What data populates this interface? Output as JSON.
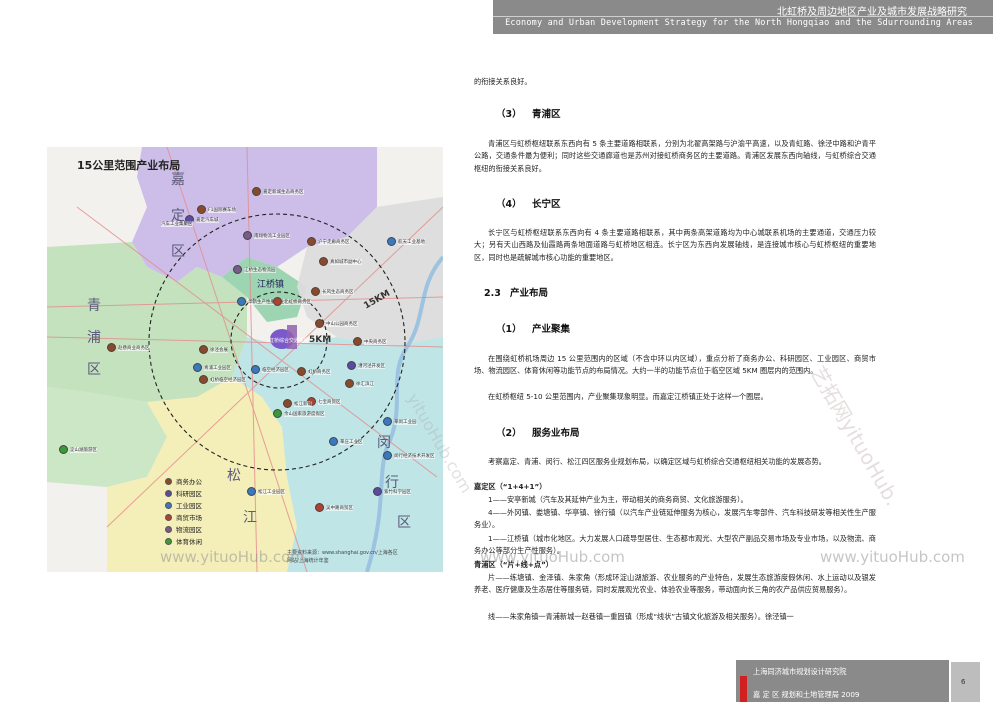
{
  "header": {
    "title_cn": "北虹桥及周边地区产业及城市发展战略研究",
    "title_en": "Economy and Urban Development Strategy for the North Hongqiao and the Sdurrounding Areas"
  },
  "map": {
    "title": "15公里范围产业布局",
    "regions": [
      "嘉",
      "定",
      "区",
      "青",
      "浦",
      "区",
      "松",
      "江",
      "闵",
      "行",
      "区",
      "江桥镇"
    ],
    "km15": "15KM",
    "km5": "5KM",
    "center_label": "虹桥综合交通枢纽",
    "nodes": [
      "嘉定汽车城",
      "汽车工业集聚区",
      "F1国际赛车场",
      "嘉定新城生态商务区",
      "南翔物流工业园区",
      "江桥生态物流园",
      "华新生产性服务业区",
      "沪宁走廊商务区",
      "真如城市副中心",
      "长风生态商务区",
      "中山公园商务区",
      "北虹桥商务区",
      "临空经济园区",
      "虹桥商务区",
      "中央商务区",
      "莘庄工业区",
      "漕河泾开发区",
      "徐汇滨江",
      "七宝商贸区",
      "闵行经济技术开发区",
      "松江工业园区",
      "松江新城",
      "佘山国家旅游度假区",
      "青浦工业园区",
      "徐泾会展",
      "赵巷商业商务区",
      "淀山湖旅游区",
      "紫竹科学园区",
      "航天工业基地",
      "莘闵工业园",
      "虹桥临空经济园区",
      "吴中路商贸区"
    ],
    "legend": [
      {
        "label": "商务办公",
        "color": "#8a4a2a"
      },
      {
        "label": "科研园区",
        "color": "#5a4aa0"
      },
      {
        "label": "工业园区",
        "color": "#3a78c0"
      },
      {
        "label": "商贸市场",
        "color": "#b04030"
      },
      {
        "label": "物流园区",
        "color": "#7a5a8a"
      },
      {
        "label": "体育休闲",
        "color": "#3a9a3a"
      }
    ],
    "footer_line1": "主要资料来源：www.shanghai.gov.cn/上海各区",
    "footer_line2": "网站/上海统计年鉴",
    "colors": {
      "jiading": "#c9b8e8",
      "qingpu": "#bfe0b8",
      "songjiang": "#f3edb5",
      "minhang": "#b9e3e6",
      "central": "#d8d8d8",
      "hub": "#7a5ac8"
    }
  },
  "watermarks": [
    "www.yituoHub.com",
    "www.yituoHub.com",
    "www.yituoHub.com",
    "艺拓网yituoHub.",
    "yituoHub.com"
  ],
  "body": {
    "intro": "的衔接关系良好。",
    "sec3_num": "（3）",
    "sec3_title": "青浦区",
    "sec3_p": "青浦区与虹桥枢纽联系东西向有 5 条主要道路相联系，分别为北翟高架路与沪渝平高速，以及青虹路、徐泾中路和沪青平公路，交通条件最为便利；同时这些交通廊道也是苏州对接虹桥商务区的主要道路。青浦区发展东西向轴线，与虹桥综合交通枢纽的衔接关系良好。",
    "sec4_num": "（4）",
    "sec4_title": "长宁区",
    "sec4_p": "长宁区与虹桥枢纽联系东西向有 4 条主要道路相联系，其中两条高架道路均为中心城联系机场的主要通道，交通压力较大；另有天山西路及仙霞路两条地面道路与虹桥地区相连。长宁区为东西向发展轴线，是连接城市核心与虹桥枢纽的重要地区，同时也是疏解城市核心功能的重要地区。",
    "sec23_num": "2.3",
    "sec23_title": "产业布局",
    "sub1_num": "（1）",
    "sub1_title": "产业聚集",
    "sub1_p1": "在围绕虹桥机场周边 15 公里范围内的区域（不含中环以内区域），重点分析了商务办公、科研园区、工业园区、商贸市场、物流园区、体育休闲等功能节点的布局情况。大约一半的功能节点位于临空区域 5KM 圈层内的范围内。",
    "sub1_p2": "在虹桥枢纽 5-10 公里范围内，产业聚集现象明显。而嘉定江桥镇正处于这样一个圈层。",
    "sub2_num": "（2）",
    "sub2_title": "服务业布局",
    "sub2_p": "考察嘉定、青浦、闵行、松江四区服务业规划布局，以确定区域与虹桥综合交通枢纽相关功能的发展态势。",
    "jd_title": "嘉定区（“1+4+1”）",
    "jd_1": "1——安亭新城（汽车及其延伸产业为主，带动相关的商务商贸、文化旅游服务）。",
    "jd_2": "4——外冈镇、娄塘镇、华亭镇、徐行镇（以汽车产业链延伸服务为核心，发展汽车零部件、汽车科技研发等相关性生产服务业）。",
    "jd_3": "1——江桥镇（城市化地区。大力发展人口疏导型居住、生态都市观光、大型农产副品交易市场及专业市场，以及物流、商务办公等部分生产性服务）。",
    "qp_title": "青浦区（“片+线+点”）",
    "qp_1": "片——练塘镇、金泽镇、朱家角（形成环淀山湖旅游、农业服务的产业特色，发展生态旅游度假休闲、水上运动以及银发养老、医疗健康及生态居住等服务链，同时发展观光农业、体验农业等服务，带动面向长三角的农产品供应贸易服务）。",
    "qp_2": "线——朱家角镇一青浦新城一赵巷镇一重固镇（形成“线状”古镇文化旅游及相关服务）。徐泾镇一"
  },
  "footer": {
    "org": "上海同济城市规划设计研究院",
    "org2": "嘉 定 区   规划和土地管理局 2009",
    "page": "6"
  }
}
